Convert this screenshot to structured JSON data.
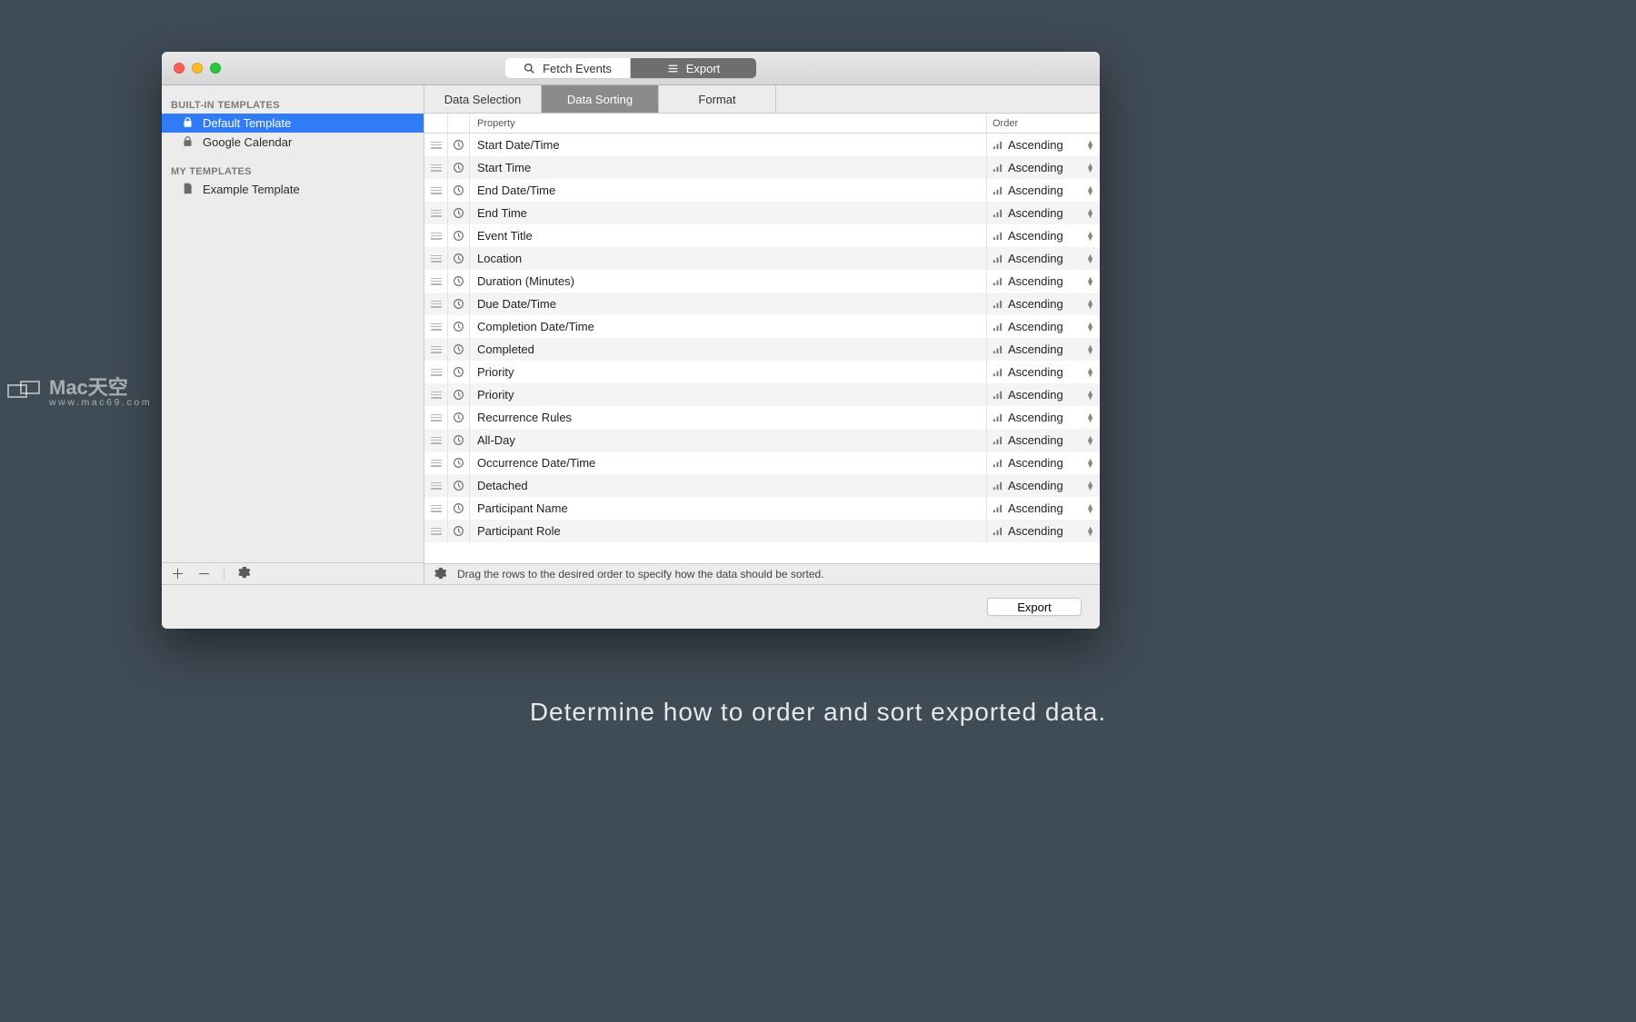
{
  "toolbar": {
    "fetch_events": "Fetch Events",
    "export": "Export"
  },
  "sidebar": {
    "section1_header": "BUILT-IN TEMPLATES",
    "section1_items": [
      {
        "label": "Default Template",
        "selected": true,
        "icon": "lock"
      },
      {
        "label": "Google Calendar",
        "selected": false,
        "icon": "lock"
      }
    ],
    "section2_header": "MY TEMPLATES",
    "section2_items": [
      {
        "label": "Example Template",
        "selected": false,
        "icon": "doc"
      }
    ]
  },
  "tabs": [
    {
      "label": "Data Selection",
      "active": false
    },
    {
      "label": "Data Sorting",
      "active": true
    },
    {
      "label": "Format",
      "active": false
    }
  ],
  "table": {
    "header_property": "Property",
    "header_order": "Order",
    "rows": [
      {
        "property": "Start Date/Time",
        "order": "Ascending"
      },
      {
        "property": "Start Time",
        "order": "Ascending"
      },
      {
        "property": "End Date/Time",
        "order": "Ascending"
      },
      {
        "property": "End Time",
        "order": "Ascending"
      },
      {
        "property": "Event Title",
        "order": "Ascending"
      },
      {
        "property": "Location",
        "order": "Ascending"
      },
      {
        "property": "Duration (Minutes)",
        "order": "Ascending"
      },
      {
        "property": "Due Date/Time",
        "order": "Ascending"
      },
      {
        "property": "Completion Date/Time",
        "order": "Ascending"
      },
      {
        "property": "Completed",
        "order": "Ascending"
      },
      {
        "property": "Priority",
        "order": "Ascending"
      },
      {
        "property": "Priority",
        "order": "Ascending"
      },
      {
        "property": "Recurrence Rules",
        "order": "Ascending"
      },
      {
        "property": "All-Day",
        "order": "Ascending"
      },
      {
        "property": "Occurrence Date/Time",
        "order": "Ascending"
      },
      {
        "property": "Detached",
        "order": "Ascending"
      },
      {
        "property": "Participant Name",
        "order": "Ascending"
      },
      {
        "property": "Participant Role",
        "order": "Ascending"
      }
    ]
  },
  "hint": "Drag the rows to the desired order to specify how the data should be sorted.",
  "export_button": "Export",
  "caption": "Determine how to order and sort exported data.",
  "watermark": {
    "line1": "Mac天空",
    "line2": "www.mac69.com"
  }
}
